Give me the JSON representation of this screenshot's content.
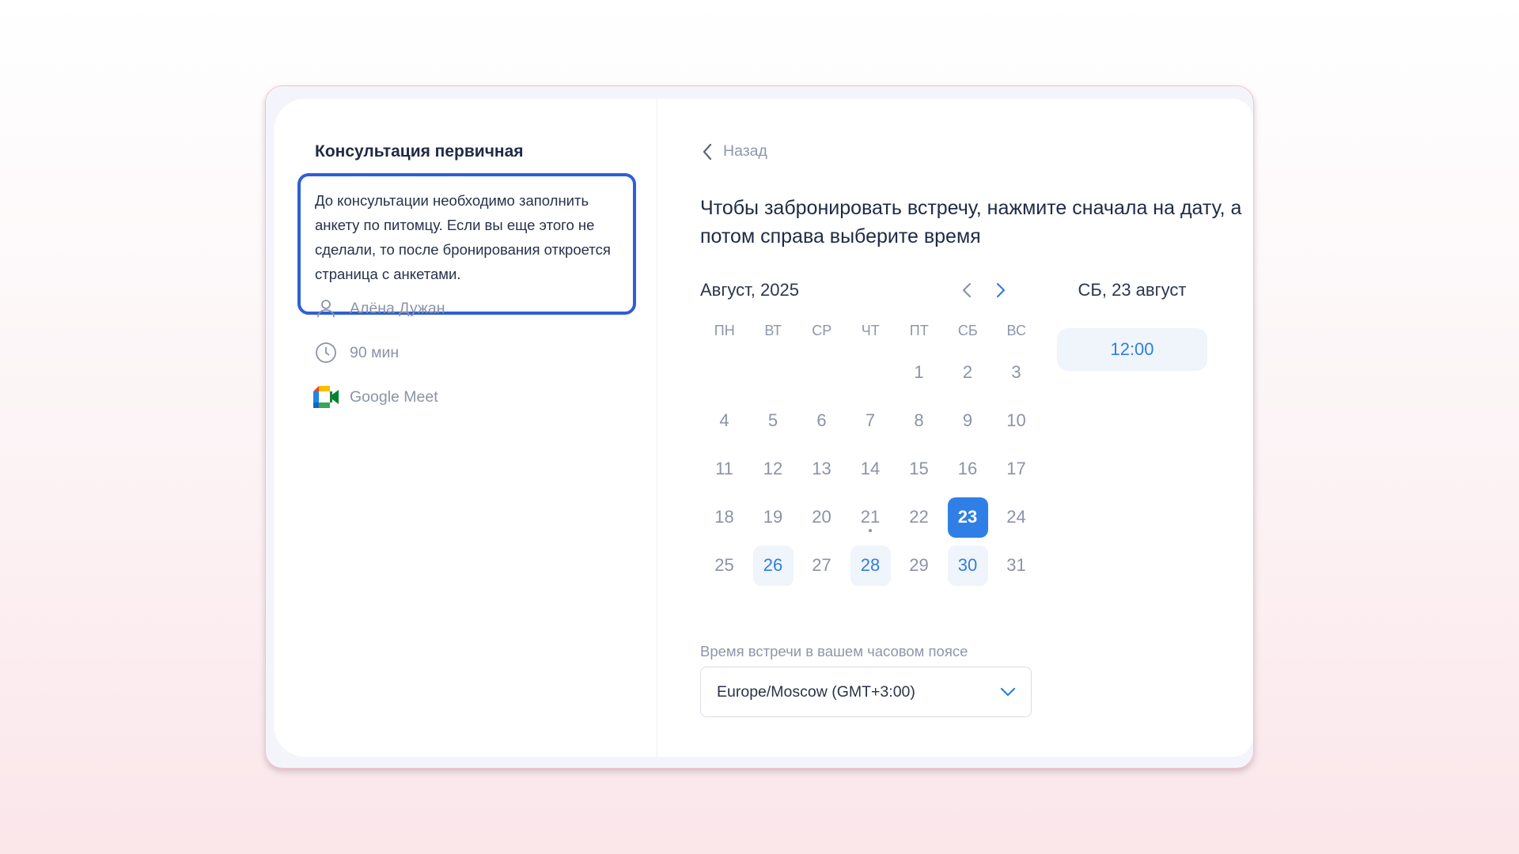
{
  "event": {
    "title": "Консультация первичная",
    "description": "До консультации необходимо заполнить анкету по питомцу. Если вы еще этого не сделали, то после бронирования откроется страница с анкетами.",
    "host": "Алёна Дужан",
    "duration": "90 мин",
    "location": "Google Meet"
  },
  "booking": {
    "back_label": "Назад",
    "instruction": "Чтобы забронировать встречу, нажмите сначала на дату, а потом справа выберите время",
    "month_label": "Август, 2025",
    "weekdays": [
      "ПН",
      "ВТ",
      "СР",
      "ЧТ",
      "ПТ",
      "СБ",
      "ВС"
    ],
    "first_weekday_index": 4,
    "days_in_month": 31,
    "selected_day": 23,
    "available_days": [
      26,
      28,
      30
    ],
    "today_marker_day": 21,
    "timezone_label": "Время встречи в вашем часовом поясе",
    "timezone_value": "Europe/Moscow (GMT+3:00)",
    "selected_date_label": "СБ, 23 август",
    "time_slots": [
      "12:00"
    ]
  },
  "colors": {
    "accent": "#2f7fe6",
    "highlight_border": "#2f5fd6",
    "available_bg": "#f0f4fb",
    "muted_text": "#8a93a8",
    "heading_text": "#1f2b45"
  },
  "icons": {
    "host": "user-icon",
    "duration": "clock-icon",
    "location": "google-meet-icon",
    "back": "chevron-left-icon",
    "prev_month": "chevron-left-icon",
    "next_month": "chevron-right-icon",
    "timezone_dropdown": "chevron-down-icon"
  }
}
